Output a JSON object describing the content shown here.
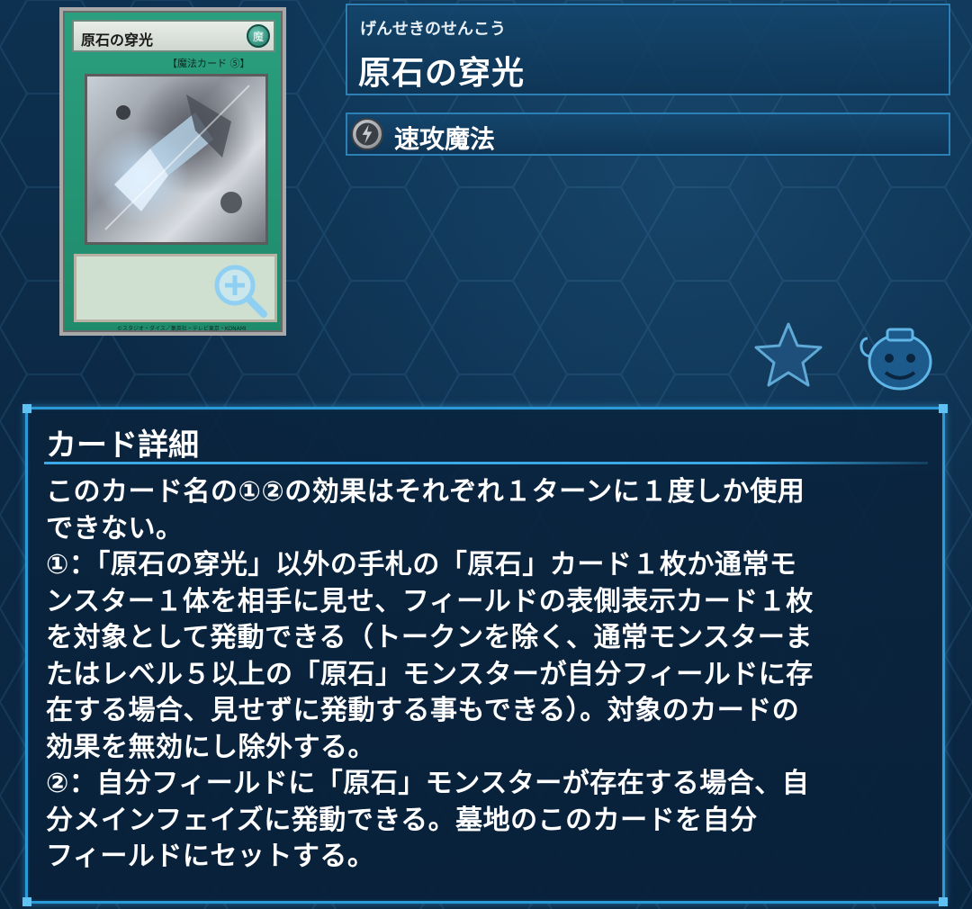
{
  "card": {
    "name_ruby": "げんせきのせんこう",
    "name": "原石の穿光",
    "spell_type": "速攻魔法",
    "thumb": {
      "name": "原石の穿光",
      "attribute": "魔",
      "type_line": "【魔法カード ⑤】",
      "copyright": "©スタジオ・ダイス／集英社・テレビ東京・KONAMI"
    }
  },
  "icons": {
    "zoom": "zoom-in-icon",
    "favorite": "star-icon",
    "mascot": "pot-of-greed-icon",
    "spell_type": "quick-play-spell-icon"
  },
  "detail": {
    "title": "カード詳細",
    "lines": [
      "このカード名の①②の効果はそれぞれ１ターンに１度しか使用",
      "できない。",
      "①：「原石の穿光」以外の手札の「原石」カード１枚か通常モ",
      "ンスター１体を相手に見せ、フィールドの表側表示カード１枚",
      "を対象として発動できる（トークンを除く、通常モンスターま",
      "たはレベル５以上の「原石」モンスターが自分フィールドに存",
      "在する場合、見せずに発動する事もできる）。対象のカードの",
      "効果を無効にし除外する。",
      "②：自分フィールドに「原石」モンスターが存在する場合、自",
      "分メインフェイズに発動できる。墓地のこのカードを自分",
      "フィールドにセットする。"
    ]
  },
  "colors": {
    "background": "#0b2a45",
    "panel_border": "#2a9ad8",
    "card_frame": "#1f8b6b"
  }
}
